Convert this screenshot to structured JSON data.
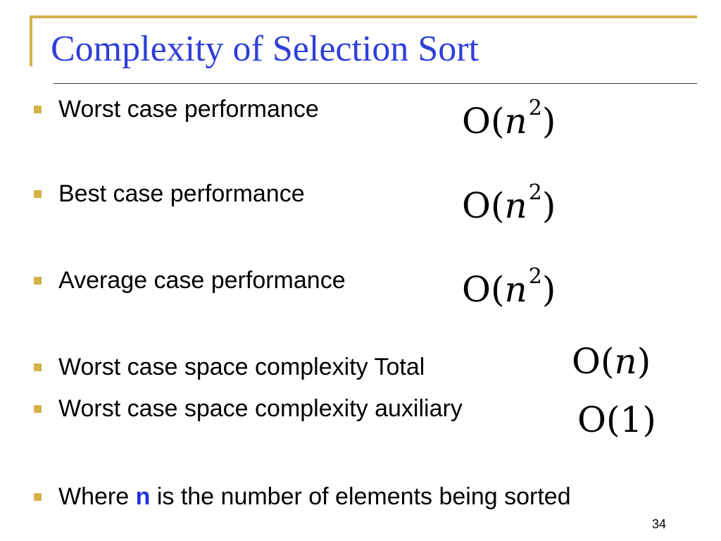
{
  "slide": {
    "title": "Complexity of Selection Sort",
    "page_number": "34"
  },
  "bullets": [
    {
      "text": "Worst case performance",
      "math": {
        "func": "O",
        "open": "(",
        "var": "n",
        "sup": "2",
        "close": ")"
      }
    },
    {
      "text": "Best case performance",
      "math": {
        "func": "O",
        "open": "(",
        "var": "n",
        "sup": "2",
        "close": ")"
      }
    },
    {
      "text": "Average case performance",
      "math": {
        "func": "O",
        "open": "(",
        "var": "n",
        "sup": "2",
        "close": ")"
      }
    },
    {
      "text": "Worst case space complexity Total",
      "math": {
        "func": "O",
        "open": "(",
        "var": "n",
        "close": ")"
      }
    },
    {
      "text": "Worst case space complexity auxiliary",
      "math": {
        "func": "O",
        "open": "(",
        "value": "1",
        "close": ")"
      }
    }
  ],
  "footnote": {
    "before": "Where ",
    "variable": "n",
    "after": " is the number of elements being sorted"
  },
  "colors": {
    "title": "#2f3fd8",
    "accent": "#d4b24a",
    "variable": "#2233dd"
  }
}
